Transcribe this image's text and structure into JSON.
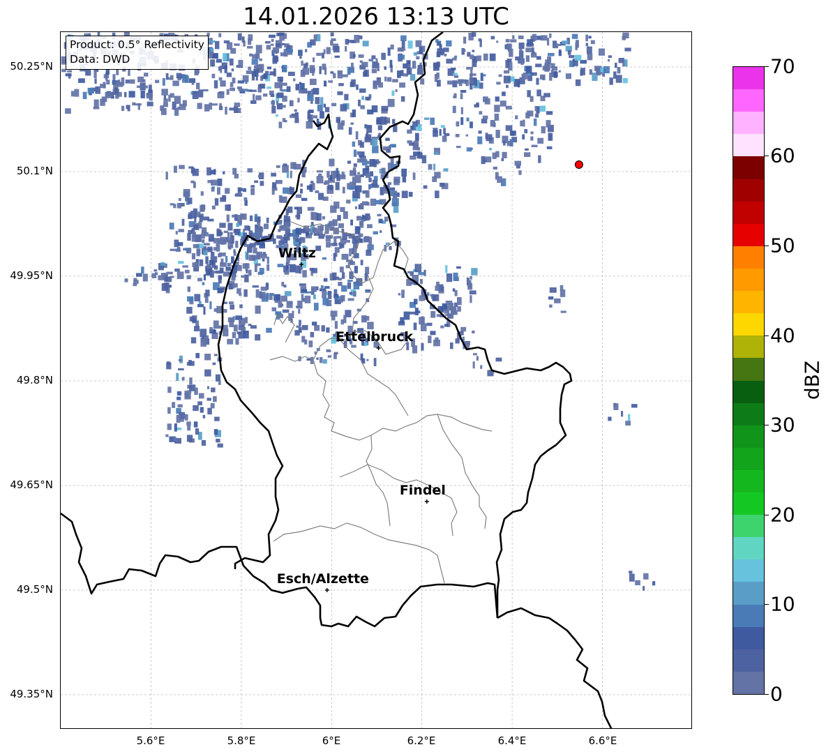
{
  "title": "14.01.2026 13:13 UTC",
  "info": {
    "product": "Product: 0.5° Reflectivity",
    "data": "Data: DWD"
  },
  "map": {
    "lat_ticks": [
      "50.25°N",
      "50.1°N",
      "49.95°N",
      "49.8°N",
      "49.65°N",
      "49.5°N",
      "49.35°N"
    ],
    "lon_ticks": [
      "5.6°E",
      "5.8°E",
      "6°E",
      "6.2°E",
      "6.4°E",
      "6.6°E"
    ],
    "cities": [
      {
        "name": "Wiltz",
        "lat": 49.967,
        "lon": 5.933
      },
      {
        "name": "Ettelbruck",
        "lat": 49.847,
        "lon": 6.104
      },
      {
        "name": "Findel",
        "lat": 49.627,
        "lon": 6.211
      },
      {
        "name": "Esch/Alzette",
        "lat": 49.5,
        "lon": 5.99
      }
    ],
    "radar_marker": {
      "lat": 50.11,
      "lon": 6.548,
      "color": "#ff0000"
    }
  },
  "colorbar": {
    "label": "dBZ",
    "ticks": [
      "0",
      "10",
      "20",
      "30",
      "40",
      "50",
      "60",
      "70"
    ],
    "min": 0,
    "max": 70,
    "colors": [
      "#6373a6",
      "#4d62a0",
      "#3f5a9f",
      "#4a7bb6",
      "#5a9ec8",
      "#66c2dd",
      "#60d6c2",
      "#3dd46d",
      "#14c823",
      "#14b81e",
      "#12a41b",
      "#11941a",
      "#0e7c16",
      "#085f10",
      "#467611",
      "#afb207",
      "#ffd700",
      "#ffb500",
      "#ff9a00",
      "#ff7f00",
      "#e60000",
      "#c10000",
      "#a10000",
      "#7c0000",
      "#ffe2ff",
      "#ffb2ff",
      "#ff66ff",
      "#ea33ea"
    ]
  }
}
